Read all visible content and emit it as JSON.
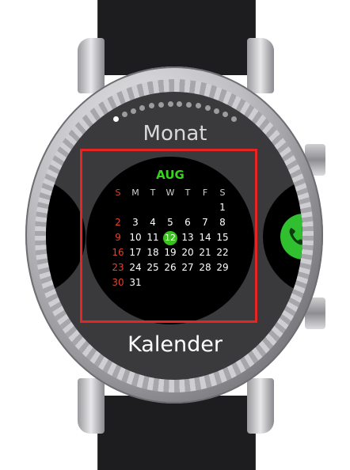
{
  "screen": {
    "page_title": "Monat",
    "app_name": "Kalender",
    "page_indicator": {
      "count": 14,
      "active_index": 0
    }
  },
  "calendar": {
    "month": "AUG",
    "weekdays": [
      "S",
      "M",
      "T",
      "W",
      "T",
      "F",
      "S"
    ],
    "weeks": [
      [
        "",
        "",
        "",
        "",
        "",
        "",
        "1"
      ],
      [
        "2",
        "3",
        "4",
        "5",
        "6",
        "7",
        "8"
      ],
      [
        "9",
        "10",
        "11",
        "12",
        "13",
        "14",
        "15"
      ],
      [
        "16",
        "17",
        "18",
        "19",
        "20",
        "21",
        "22"
      ],
      [
        "23",
        "24",
        "25",
        "26",
        "27",
        "28",
        "29"
      ],
      [
        "30",
        "31",
        "",
        "",
        "",
        "",
        ""
      ]
    ],
    "today": "12"
  },
  "side_widgets": {
    "right_icon": "phone-icon"
  },
  "colors": {
    "accent_green": "#39d21e",
    "sunday_red": "#e0432f",
    "highlight_frame": "#e52424",
    "phone_green": "#2fbf2f"
  }
}
